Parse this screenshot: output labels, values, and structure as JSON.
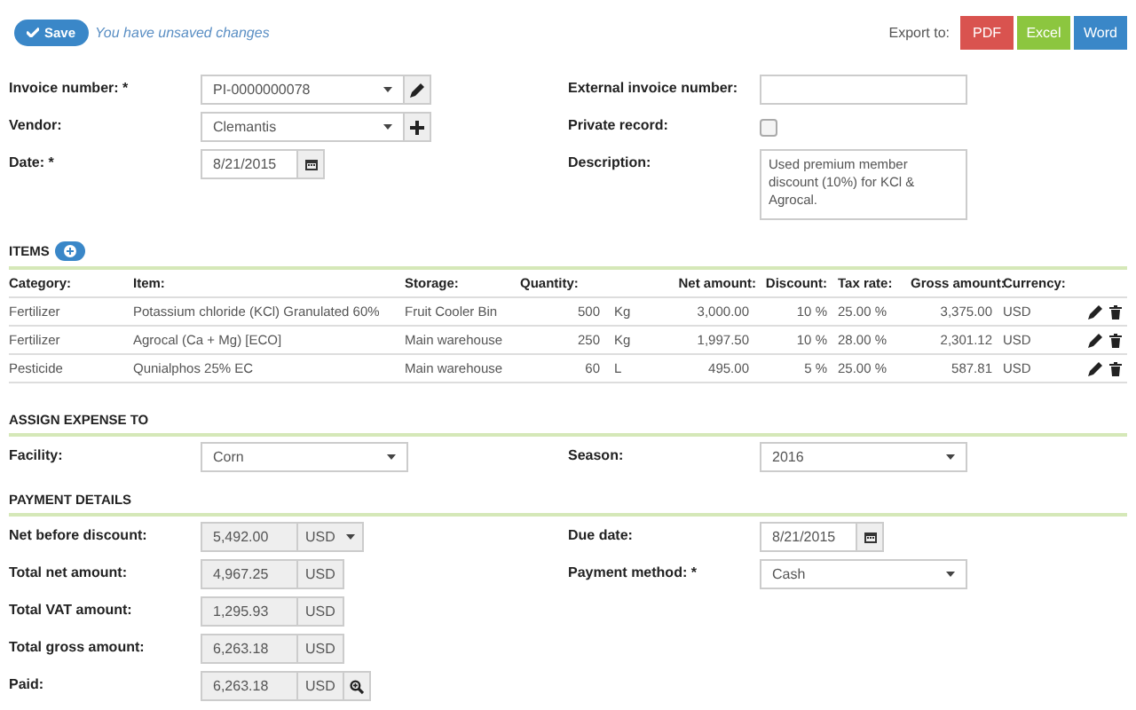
{
  "toolbar": {
    "save_button": "Save",
    "status": "You have unsaved changes",
    "export_label": "Export to:",
    "export_buttons": [
      {
        "label": "PDF",
        "color": "#d9534f"
      },
      {
        "label": "Excel",
        "color": "#8cc63f"
      },
      {
        "label": "Word",
        "color": "#3a87c8"
      }
    ]
  },
  "invoice": {
    "left": [
      {
        "label": "Invoice number: *",
        "kind": "select_edit",
        "value": "PI-0000000078"
      },
      {
        "label": "Vendor:",
        "kind": "select_add",
        "value": "Clemantis"
      },
      {
        "label": "Date: *",
        "kind": "date",
        "value": "8/21/2015"
      }
    ],
    "right": [
      {
        "label": "External invoice number:",
        "kind": "text"
      },
      {
        "label": "Private record:",
        "kind": "checkbox",
        "checked": false
      },
      {
        "label": "Description:",
        "kind": "textarea",
        "value": "Used premium member discount (10%) for KCl & Agrocal."
      }
    ]
  },
  "items": {
    "title": "ITEMS",
    "columns": [
      "Category:",
      "Item:",
      "Storage:",
      "Quantity:",
      "Net amount:",
      "Discount:",
      "Tax rate:",
      "Gross amount:",
      "Currency:"
    ],
    "rows": [
      {
        "category": "Fertilizer",
        "item": "Potassium chloride (KCl) Granulated 60%",
        "storage": "Fruit Cooler Bin",
        "quantity": "500",
        "unit": "Kg",
        "net_amount": "3,000.00",
        "discount": "10 %",
        "tax_rate": "25.00 %",
        "gross_amount": "3,375.00",
        "currency": "USD"
      },
      {
        "category": "Fertilizer",
        "item": "Agrocal (Ca + Mg) [ECO]",
        "storage": "Main warehouse",
        "quantity": "250",
        "unit": "Kg",
        "net_amount": "1,997.50",
        "discount": "10 %",
        "tax_rate": "28.00 %",
        "gross_amount": "2,301.12",
        "currency": "USD"
      },
      {
        "category": "Pesticide",
        "item": "Qunialphos 25% EC",
        "storage": "Main warehouse",
        "quantity": "60",
        "unit": "L",
        "net_amount": "495.00",
        "discount": "5 %",
        "tax_rate": "25.00 %",
        "gross_amount": "587.81",
        "currency": "USD"
      }
    ]
  },
  "expense": {
    "title": "ASSIGN EXPENSE TO",
    "left": [
      {
        "label": "Facility:",
        "kind": "select",
        "value": "Corn"
      }
    ],
    "right": [
      {
        "label": "Season:",
        "kind": "select",
        "value": "2016"
      }
    ]
  },
  "payment": {
    "title": "PAYMENT DETAILS",
    "left": [
      {
        "label": "Net before discount:",
        "kind": "amount_select",
        "value": "5,492.00",
        "currency": "USD"
      },
      {
        "label": "Total net amount:",
        "kind": "amount",
        "value": "4,967.25",
        "currency": "USD"
      },
      {
        "label": "Total VAT amount:",
        "kind": "amount",
        "value": "1,295.93",
        "currency": "USD"
      },
      {
        "label": "Total gross amount:",
        "kind": "amount",
        "value": "6,263.18",
        "currency": "USD"
      },
      {
        "label": "Paid:",
        "kind": "amount_lookup",
        "value": "6,263.18",
        "currency": "USD"
      }
    ],
    "right": [
      {
        "label": "Due date:",
        "kind": "date",
        "value": "8/21/2015"
      },
      {
        "label": "Payment method: *",
        "kind": "select",
        "value": "Cash"
      }
    ]
  }
}
